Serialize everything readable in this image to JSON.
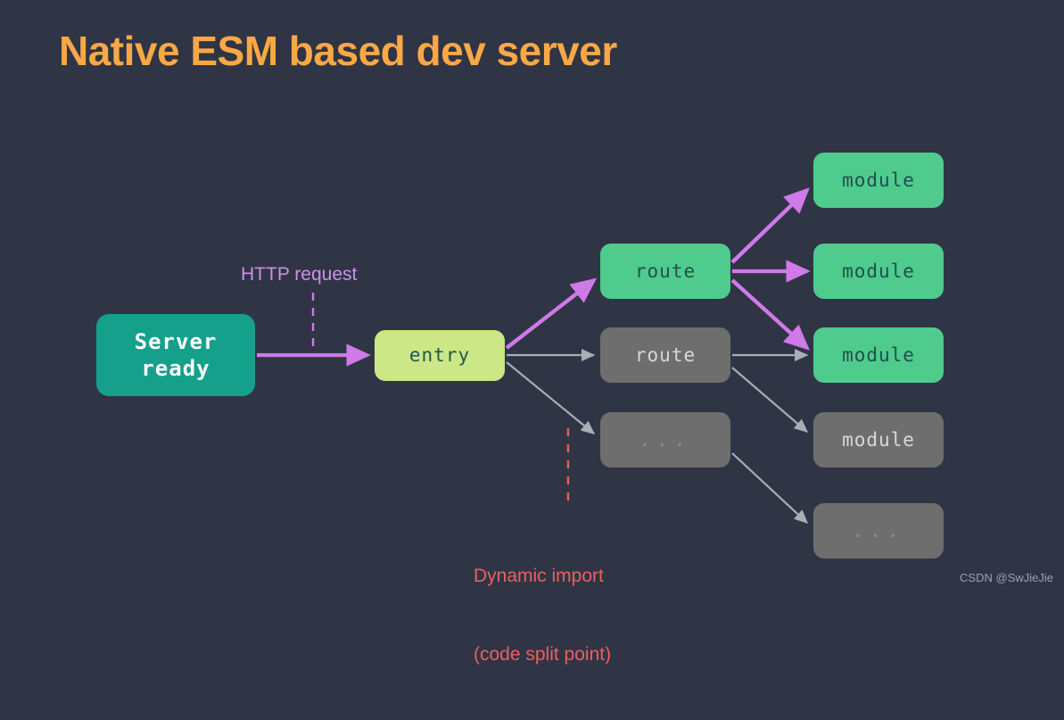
{
  "slide": {
    "title": "Native ESM based dev server",
    "background_color": "#2f3545",
    "title_color": "#f9a845",
    "watermark": "CSDN @SwJieJie"
  },
  "nodes": {
    "server": {
      "label": "Server\nready",
      "line1": "Server",
      "line2": "ready",
      "fill": "#15a08c",
      "text_color": "#ffffff"
    },
    "entry": {
      "label": "entry",
      "fill": "#cbe786",
      "text_color": "#22574f"
    },
    "route_active": {
      "label": "route",
      "fill": "#4ecb8d",
      "text_color": "#22504c"
    },
    "route_inactive": {
      "label": "route",
      "fill": "#6e6e6e",
      "text_color": "#d8d8d8"
    },
    "route_dots": {
      "label": "...",
      "fill": "#6e6e6e",
      "text_color": "#8e8e8e"
    },
    "module_1": {
      "label": "module",
      "fill": "#4ecb8d",
      "text_color": "#22504c"
    },
    "module_2": {
      "label": "module",
      "fill": "#4ecb8d",
      "text_color": "#22504c"
    },
    "module_3": {
      "label": "module",
      "fill": "#4ecb8d",
      "text_color": "#22504c"
    },
    "module_4": {
      "label": "module",
      "fill": "#6e6e6e",
      "text_color": "#d8d8d8"
    },
    "module_5": {
      "label": "...",
      "fill": "#6e6e6e",
      "text_color": "#8e8e8e"
    }
  },
  "annotations": {
    "http_request": {
      "text": "HTTP request",
      "color": "#cf8ee8"
    },
    "dynamic_import_line1": {
      "text": "Dynamic import",
      "color": "#ec5f5f"
    },
    "dynamic_import_line2": {
      "text": "(code split point)",
      "color": "#ec5f5f"
    }
  },
  "edge_colors": {
    "active": "#cf7ae8",
    "inactive": "#a9adb5"
  }
}
